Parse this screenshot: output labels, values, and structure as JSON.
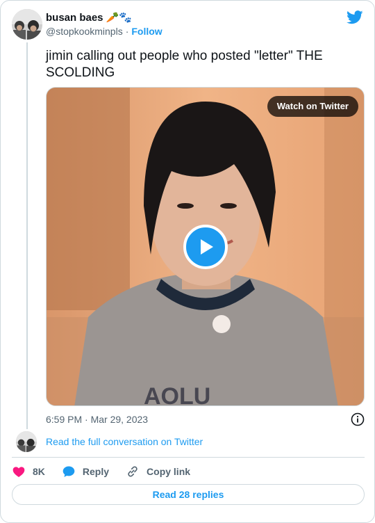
{
  "author": {
    "display_name": "busan baes",
    "emojis": "🥕🐾",
    "handle": "@stopkookminpls",
    "separator": "·",
    "follow_label": "Follow"
  },
  "tweet": {
    "text": "jimin calling out people who posted \"letter\" THE SCOLDING",
    "timestamp": "6:59 PM · Mar 29, 2023"
  },
  "media": {
    "type": "video",
    "watch_label": "Watch on Twitter"
  },
  "conversation": {
    "link_label": "Read the full conversation on Twitter"
  },
  "actions": {
    "likes_count": "8K",
    "reply_label": "Reply",
    "copy_label": "Copy link"
  },
  "footer": {
    "read_replies_label": "Read 28 replies"
  },
  "colors": {
    "accent": "#1d9bf0",
    "like": "#f91880",
    "muted_text": "#536471",
    "border": "#cfd9de"
  },
  "icons": [
    "twitter-bird-icon",
    "play-icon",
    "info-icon",
    "heart-icon",
    "reply-bubble-icon",
    "link-icon"
  ]
}
